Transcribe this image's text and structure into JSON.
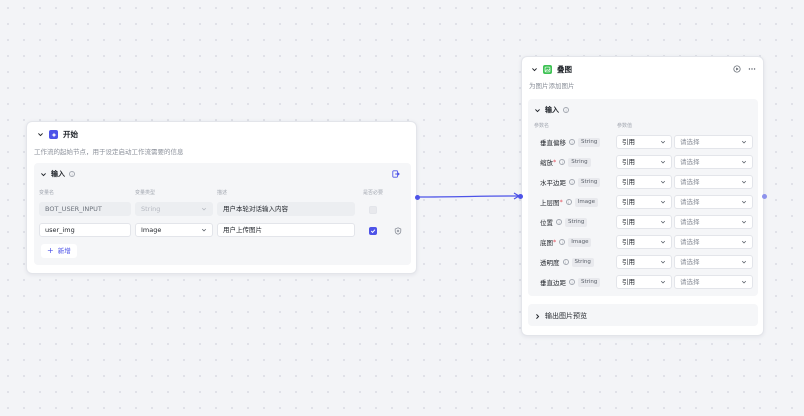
{
  "start_node": {
    "title": "开始",
    "description": "工作流的起始节点，用于设定启动工作流需要的信息",
    "input_section": {
      "label": "输入",
      "columns": [
        "变量名",
        "变量类型",
        "描述",
        "是否必要"
      ],
      "rows": [
        {
          "name": "BOT_USER_INPUT",
          "type": "String",
          "description": "用户本轮对话输入内容",
          "required": false,
          "disabled": true
        },
        {
          "name": "user_img",
          "type": "Image",
          "description": "用户上传图片",
          "required": true,
          "disabled": false
        }
      ],
      "add_label": "新增"
    }
  },
  "overlay_node": {
    "title": "叠图",
    "description": "为图片添加图片",
    "input_section": {
      "label": "输入",
      "columns": [
        "参数名",
        "参数值"
      ],
      "params": [
        {
          "name": "垂直偏移",
          "required": false,
          "type": "String",
          "mode": "引用",
          "value_placeholder": "请选择"
        },
        {
          "name": "缩放",
          "required": true,
          "type": "String",
          "mode": "引用",
          "value_placeholder": "请选择"
        },
        {
          "name": "水平边距",
          "required": false,
          "type": "String",
          "mode": "引用",
          "value_placeholder": "请选择"
        },
        {
          "name": "上层图",
          "required": true,
          "type": "Image",
          "mode": "引用",
          "value_placeholder": "请选择"
        },
        {
          "name": "位置",
          "required": false,
          "type": "String",
          "mode": "引用",
          "value_placeholder": "请选择"
        },
        {
          "name": "底图",
          "required": true,
          "type": "Image",
          "mode": "引用",
          "value_placeholder": "请选择"
        },
        {
          "name": "透明度",
          "required": false,
          "type": "String",
          "mode": "引用",
          "value_placeholder": "请选择"
        },
        {
          "name": "垂直边距",
          "required": false,
          "type": "String",
          "mode": "引用",
          "value_placeholder": "请选择"
        }
      ]
    },
    "output_section": {
      "label": "输出图片预览"
    }
  },
  "colors": {
    "accent": "#4d53e8",
    "start_icon": "#4d53e8",
    "overlay_icon": "#3ec254"
  },
  "icons": {
    "start": "flag-icon",
    "overlay": "image-overlay-icon",
    "run": "play-icon",
    "more": "more-icon"
  }
}
